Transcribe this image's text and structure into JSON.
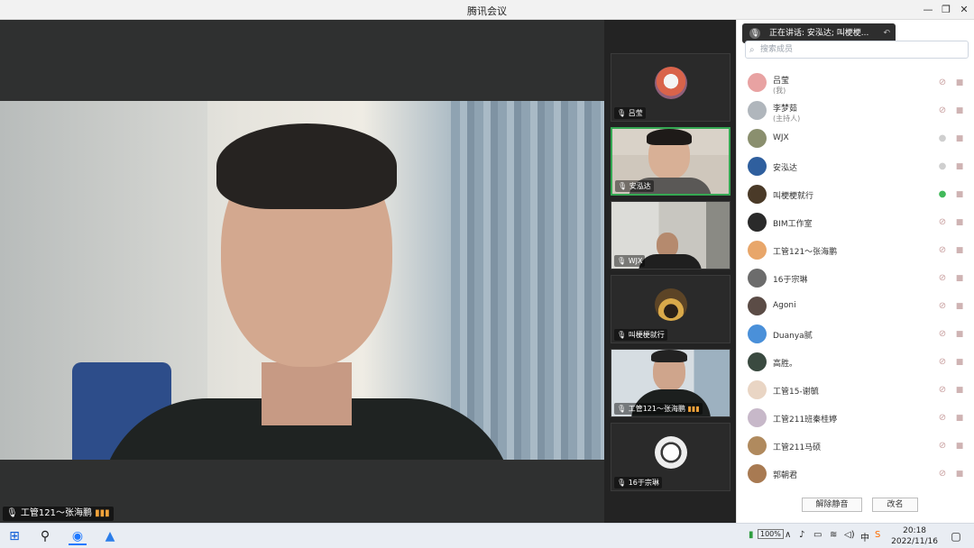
{
  "window": {
    "title": "腾讯会议",
    "controls": [
      "—",
      "❐",
      "✕"
    ]
  },
  "main_video": {
    "speaker_label": "工管121～张海鹏"
  },
  "thumbnails": [
    {
      "name": "吕莹"
    },
    {
      "name": "安泓达"
    },
    {
      "name": "WJX"
    },
    {
      "name": "叫梗梗就行"
    },
    {
      "name": "工管121～张海鹏"
    },
    {
      "name": "16于宗琳"
    }
  ],
  "toast": {
    "text": "正在讲话: 安泓达; 叫梗梗..."
  },
  "panel": {
    "search_placeholder": "搜索成员",
    "more_label": "···",
    "close_label": "✕",
    "menu_label": "≡",
    "members": [
      {
        "name": "吕莹",
        "sub": "(我)",
        "color": "#e8a2a2",
        "mic": "muted"
      },
      {
        "name": "李梦茹",
        "sub": "(主持人)",
        "color": "#b0b6bc",
        "mic": "muted"
      },
      {
        "name": "WJX",
        "sub": "",
        "color": "#8a8f6e",
        "mic": "on"
      },
      {
        "name": "安泓达",
        "sub": "",
        "color": "#2f5f9e",
        "mic": "on"
      },
      {
        "name": "叫梗梗就行",
        "sub": "",
        "color": "#4a3a28",
        "mic": "talking"
      },
      {
        "name": "BIM工作室",
        "sub": "",
        "color": "#2a2a2a",
        "mic": "muted"
      },
      {
        "name": "工管121～张海鹏",
        "sub": "",
        "color": "#e8a66a",
        "mic": "muted"
      },
      {
        "name": "16于宗琳",
        "sub": "",
        "color": "#6c6c6c",
        "mic": "muted"
      },
      {
        "name": "Agoni",
        "sub": "",
        "color": "#5b4c46",
        "mic": "muted"
      },
      {
        "name": "Duanya腻",
        "sub": "",
        "color": "#4a90d9",
        "mic": "muted"
      },
      {
        "name": "高胜。",
        "sub": "",
        "color": "#3a4a40",
        "mic": "muted"
      },
      {
        "name": "工管15-谢毓",
        "sub": "",
        "color": "#e9d5c4",
        "mic": "muted"
      },
      {
        "name": "工管211班秦桂婷",
        "sub": "",
        "color": "#c7b8c9",
        "mic": "muted"
      },
      {
        "name": "工管211马硕",
        "sub": "",
        "color": "#b08a5e",
        "mic": "muted"
      },
      {
        "name": "郭朝君",
        "sub": "",
        "color": "#a87a52",
        "mic": "muted"
      }
    ],
    "unmute_all_label": "解除静音",
    "rename_label": "改名"
  },
  "taskbar": {
    "battery": "100%",
    "ime_label": "中",
    "time": "20:18",
    "date": "2022/11/16"
  }
}
